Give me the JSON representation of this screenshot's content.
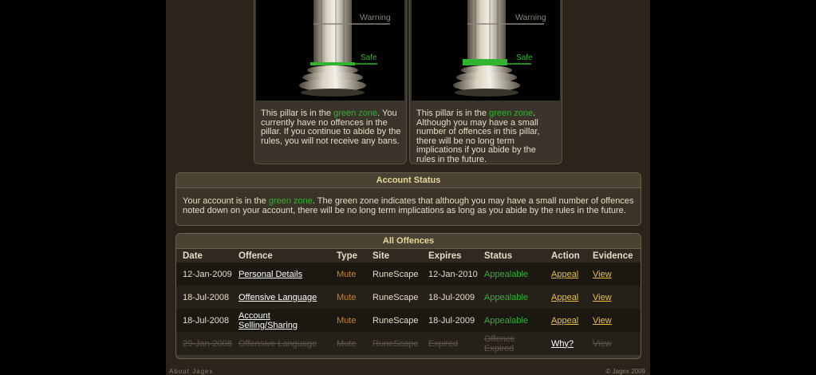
{
  "pillars": [
    {
      "warning_label": "Warning",
      "safe_label": "Safe",
      "text_prefix": "This pillar is in the ",
      "zone": "green zone",
      "text_suffix": ". You currently have no offences in the pillar. If you continue to abide by the rules, you will not receive any bans."
    },
    {
      "warning_label": "Warning",
      "safe_label": "Safe",
      "text_prefix": "This pillar is in the ",
      "zone": "green zone",
      "text_suffix": ". Although you may have a small number of offences in this pillar, there will be no long term implications if you abide by the rules in the future."
    }
  ],
  "account_status": {
    "title": "Account Status",
    "text_prefix": "Your account is in the ",
    "zone": "green zone",
    "text_suffix": ". The green zone indicates that although you may have a small number of offences noted down on your account, there will be no long term implications as long as you abide by the rules in the future."
  },
  "offences": {
    "title": "All Offences",
    "headers": [
      "Date",
      "Offence",
      "Type",
      "Site",
      "Expires",
      "Status",
      "Action",
      "Evidence"
    ],
    "rows": [
      {
        "date": "12-Jan-2009",
        "offence": "Personal Details",
        "type": "Mute",
        "site": "RuneScape",
        "expires": "12-Jan-2010",
        "status": "Appealable",
        "action": "Appeal",
        "evidence": "View"
      },
      {
        "date": "18-Jul-2008",
        "offence": "Offensive Language",
        "type": "Mute",
        "site": "RuneScape",
        "expires": "18-Jul-2009",
        "status": "Appealable",
        "action": "Appeal",
        "evidence": "View"
      },
      {
        "date": "18-Jul-2008",
        "offence": "Account Selling/Sharing",
        "type": "Mute",
        "site": "RuneScape",
        "expires": "18-Jul-2009",
        "status": "Appealable",
        "action": "Appeal",
        "evidence": "View"
      },
      {
        "date": "29-Jan-2008",
        "offence": "Offensive Language",
        "type": "Mute",
        "site": "RuneScape",
        "expires": "Expired",
        "status": "Offence Expired",
        "action": "Why?",
        "evidence": "View"
      }
    ]
  },
  "footer": {
    "left": "About Jagex",
    "right": "© Jagex 2009"
  },
  "colors": {
    "zone_green": "#2fb52f",
    "mute_orange": "#c8842a",
    "link_yellow": "#f0c030",
    "title_gold": "#e9d79c"
  }
}
